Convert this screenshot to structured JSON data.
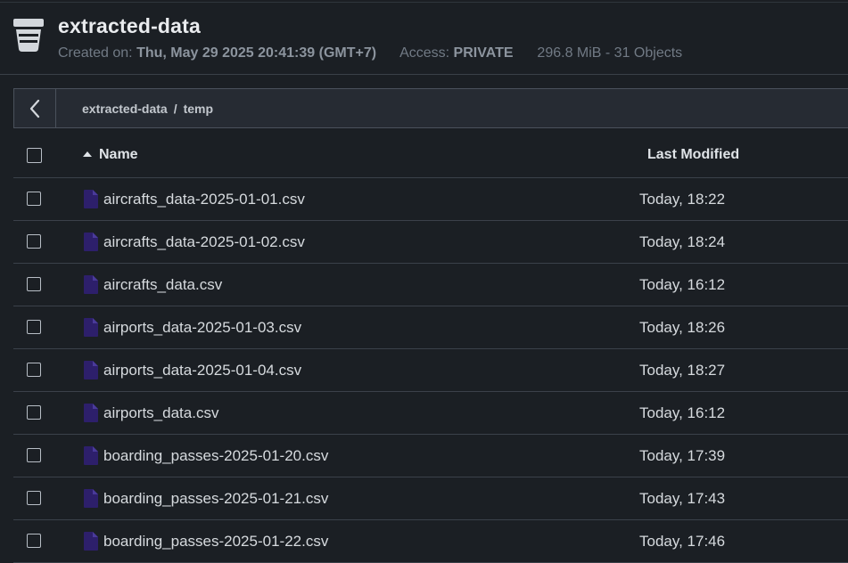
{
  "bucket": {
    "name": "extracted-data",
    "created_label": "Created on:",
    "created_value": "Thu, May 29 2025 20:41:39 (GMT+7)",
    "access_label": "Access:",
    "access_value": "PRIVATE",
    "usage": "296.8 MiB - 31 Objects",
    "icon": "bucket-icon"
  },
  "breadcrumb": {
    "back_icon": "chevron-left-icon",
    "items": [
      "extracted-data",
      "temp"
    ],
    "separator": "/"
  },
  "table": {
    "columns": {
      "name": "Name",
      "modified": "Last Modified"
    },
    "sort": "name-ascending",
    "rows": [
      {
        "name": "aircrafts_data-2025-01-01.csv",
        "modified": "Today, 18:22"
      },
      {
        "name": "aircrafts_data-2025-01-02.csv",
        "modified": "Today, 18:24"
      },
      {
        "name": "aircrafts_data.csv",
        "modified": "Today, 16:12"
      },
      {
        "name": "airports_data-2025-01-03.csv",
        "modified": "Today, 18:26"
      },
      {
        "name": "airports_data-2025-01-04.csv",
        "modified": "Today, 18:27"
      },
      {
        "name": "airports_data.csv",
        "modified": "Today, 16:12"
      },
      {
        "name": "boarding_passes-2025-01-20.csv",
        "modified": "Today, 17:39"
      },
      {
        "name": "boarding_passes-2025-01-21.csv",
        "modified": "Today, 17:43"
      },
      {
        "name": "boarding_passes-2025-01-22.csv",
        "modified": "Today, 17:46"
      }
    ]
  },
  "colors": {
    "background": "#1b1f24",
    "file_icon": "#2d1f6b",
    "border": "#3b414a"
  }
}
